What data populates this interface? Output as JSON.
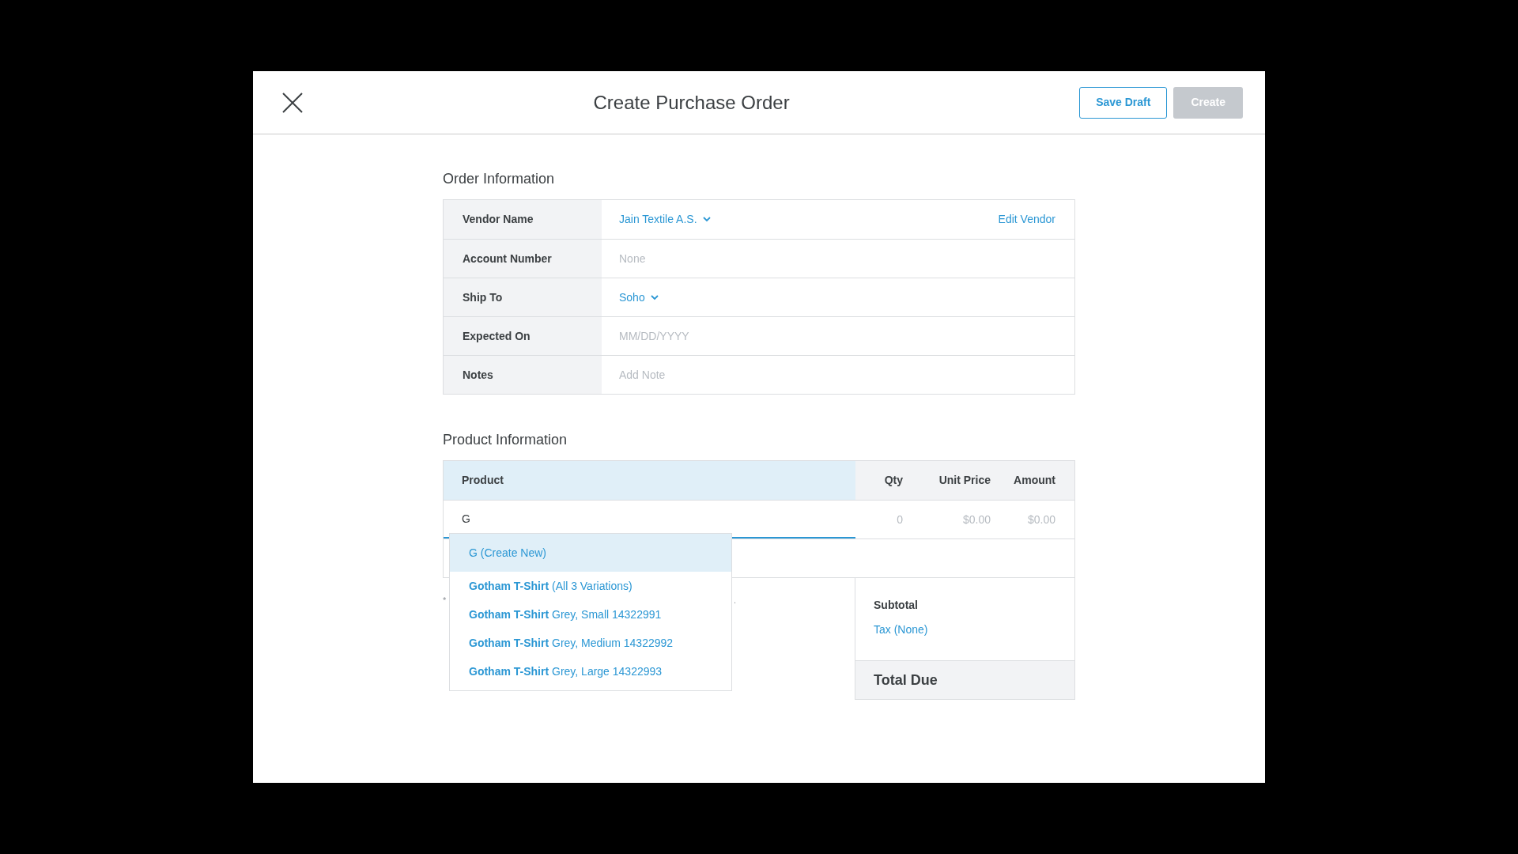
{
  "header": {
    "title": "Create Purchase Order",
    "buttons": [
      {
        "label": "Save Draft",
        "kind": "outline",
        "disabled": false
      },
      {
        "label": "Create",
        "kind": "primary",
        "disabled": true
      }
    ]
  },
  "order_information": {
    "heading": "Order Information",
    "rows": [
      {
        "label": "Vendor Name",
        "kind": "select",
        "value": "Jain Textile A.S.",
        "action": "Edit Vendor"
      },
      {
        "label": "Account Number",
        "kind": "input",
        "placeholder": "None"
      },
      {
        "label": "Ship To",
        "kind": "select",
        "value": "Soho"
      },
      {
        "label": "Expected On",
        "kind": "input",
        "placeholder": "MM/DD/YYYY"
      },
      {
        "label": "Notes",
        "kind": "input",
        "placeholder": "Add Note"
      }
    ]
  },
  "product_information": {
    "heading": "Product Information",
    "columns": [
      {
        "label": "Product",
        "selected": true
      },
      {
        "label": "Qty",
        "selected": false
      },
      {
        "label": "Unit Price",
        "selected": false
      },
      {
        "label": "Amount",
        "selected": false
      }
    ],
    "row": {
      "product": "G",
      "qty": "0",
      "unit_price": "$0.00",
      "amount": "$0.00"
    },
    "suggestions": [
      {
        "text": "G (Create New)",
        "selected": true
      },
      {
        "text": "**Gotham T-Shirt** (All 3 Variations)",
        "selected": false
      },
      {
        "text": "**Gotham T-Shirt** Grey, Small 14322991",
        "selected": false
      },
      {
        "text": "**Gotham T-Shirt** Grey, Medium 14322992",
        "selected": false
      },
      {
        "text": "**Gotham T-Shirt** Grey, Large 14322993",
        "selected": false
      }
    ],
    "note_start": "*",
    "note_end": ".",
    "totals": {
      "subtotal": "Subtotal",
      "tax": "Tax (None)",
      "total": "Total Due"
    }
  }
}
